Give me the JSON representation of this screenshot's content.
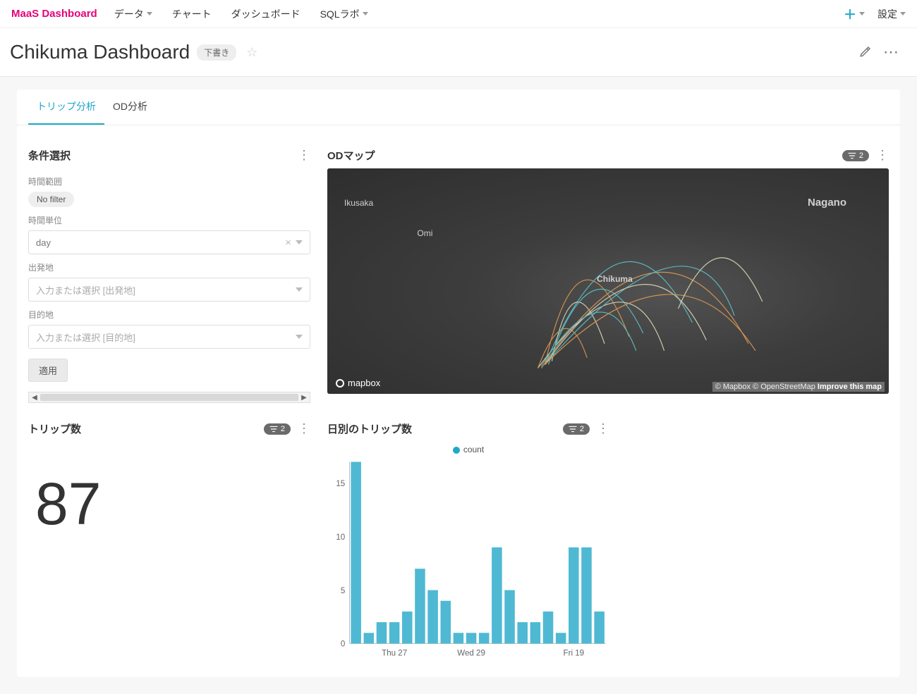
{
  "nav": {
    "brand": "MaaS Dashboard",
    "items": [
      "データ",
      "チャート",
      "ダッシュボード",
      "SQLラボ"
    ],
    "settings": "設定"
  },
  "header": {
    "title": "Chikuma Dashboard",
    "draft_label": "下書き"
  },
  "tabs": {
    "trip": "トリップ分析",
    "od": "OD分析"
  },
  "filters": {
    "title": "条件選択",
    "time_range_label": "時間範囲",
    "no_filter": "No filter",
    "time_unit_label": "時間単位",
    "time_unit_value": "day",
    "origin_label": "出発地",
    "origin_placeholder": "入力または選択 [出発地]",
    "dest_label": "目的地",
    "dest_placeholder": "入力または選択 [目的地]",
    "apply": "適用"
  },
  "map": {
    "title": "ODマップ",
    "labels": {
      "nagano": "Nagano",
      "chikuma": "Chikuma",
      "omi": "Omi",
      "ikusaka": "Ikusaka"
    },
    "mapbox": "mapbox",
    "attrib_left": "© Mapbox © OpenStreetMap",
    "attrib_right": "Improve this map",
    "filter_count": "2"
  },
  "trip_count": {
    "title": "トリップ数",
    "value": "87",
    "filter_count": "2"
  },
  "daily": {
    "title": "日別のトリップ数",
    "legend": "count",
    "filter_count": "2"
  },
  "chart_data": {
    "type": "bar",
    "title": "日別のトリップ数",
    "xlabel": "",
    "ylabel": "",
    "ylim": [
      0,
      17
    ],
    "yticks": [
      0,
      5,
      10,
      15
    ],
    "categories": [
      "",
      "",
      "",
      "Thu 27",
      "",
      "",
      "",
      "Wed 29",
      "",
      "",
      "",
      "Fri 19",
      "",
      ""
    ],
    "series": [
      {
        "name": "count",
        "values": [
          17,
          1,
          2,
          2,
          3,
          7,
          5,
          4,
          1,
          1,
          1,
          9,
          5,
          2,
          2,
          3,
          1,
          9,
          9,
          3
        ]
      }
    ]
  }
}
